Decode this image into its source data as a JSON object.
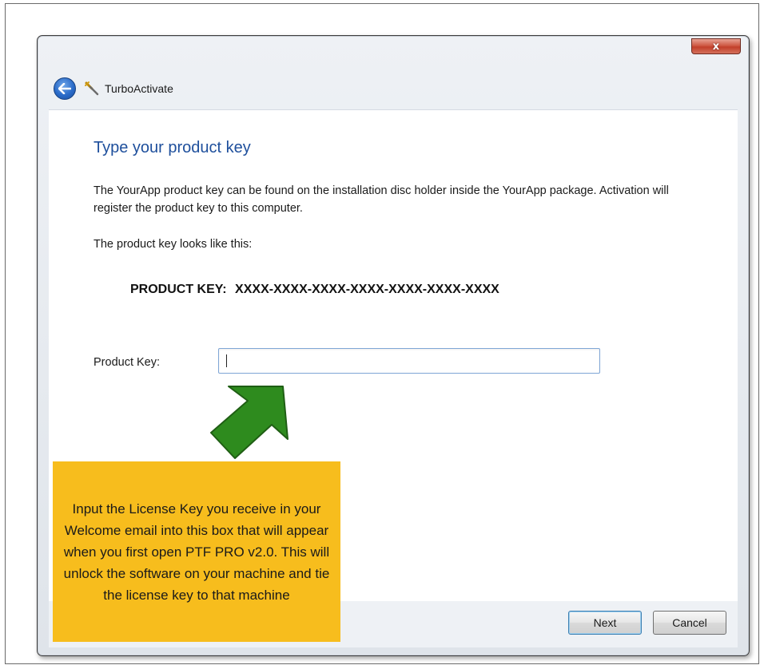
{
  "window": {
    "title": "TurboActivate",
    "close_label": "x"
  },
  "page": {
    "heading": "Type your product key",
    "description": "The YourApp product key can be found on the installation disc holder inside the YourApp package. Activation will register the product key to this computer.",
    "looks_like": "The product key looks like this:",
    "example_label": "PRODUCT KEY:",
    "example_value": "XXXX-XXXX-XXXX-XXXX-XXXX-XXXX-XXXX"
  },
  "form": {
    "product_key_label": "Product Key:",
    "product_key_value": ""
  },
  "buttons": {
    "next": "Next",
    "cancel": "Cancel"
  },
  "callout": {
    "text": "Input the License Key you receive in your Welcome email into this box that will appear when you first open PTF PRO v2.0.  This will unlock the software on your machine and tie the license key to that machine"
  },
  "colors": {
    "heading": "#1e4f9c",
    "callout_bg": "#f7bd1d",
    "arrow_green": "#2e8b1e"
  },
  "icons": {
    "back": "back-arrow-icon",
    "app": "turboactivate-app-icon",
    "pointer": "green-arrow-icon"
  }
}
